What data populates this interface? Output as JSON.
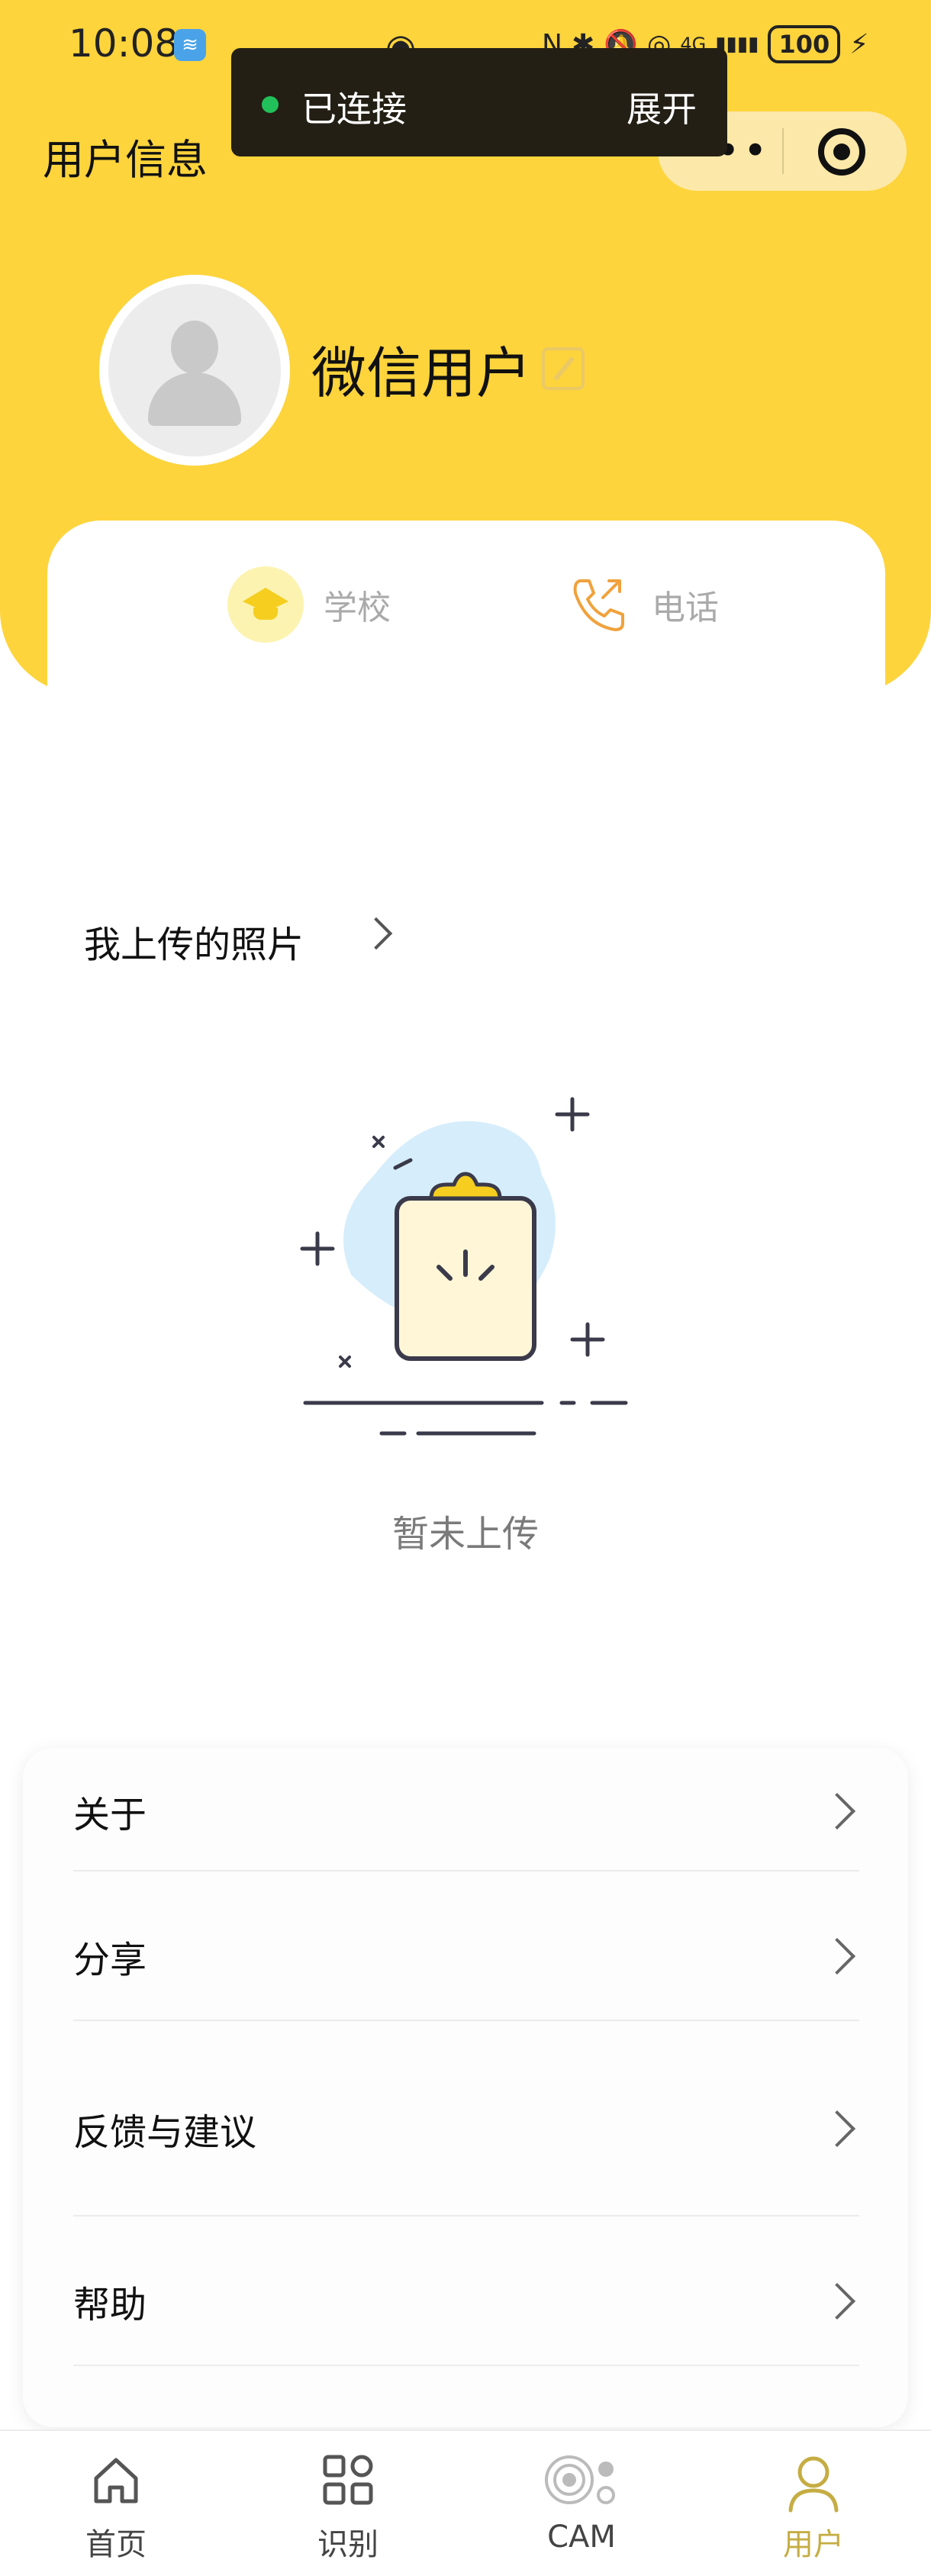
{
  "status_bar": {
    "time": "10:08",
    "right_indicators": [
      "N",
      "✱",
      "🔕",
      "◎",
      "4G",
      "▮▮▮▮"
    ],
    "battery": "100"
  },
  "toast": {
    "status_text": "已连接",
    "expand_label": "展开",
    "status_color": "#22c05a"
  },
  "header": {
    "title": "用户信息",
    "more_label": "•••",
    "accent_color": "#FDD43C"
  },
  "profile": {
    "username": "微信用户",
    "school_label": "学校",
    "phone_label": "电话"
  },
  "photos": {
    "section_title": "我上传的照片",
    "empty_text": "暂未上传"
  },
  "menu": {
    "items": [
      {
        "label": "关于"
      },
      {
        "label": "分享"
      },
      {
        "label": "反馈与建议"
      },
      {
        "label": "帮助"
      }
    ]
  },
  "tabbar": {
    "items": [
      {
        "label": "首页",
        "icon": "home-icon"
      },
      {
        "label": "识别",
        "icon": "grid-icon"
      },
      {
        "label": "CAM",
        "icon": "cam-icon"
      },
      {
        "label": "用户",
        "icon": "user-icon",
        "active": true
      }
    ],
    "active_color": "#c5ad44"
  }
}
